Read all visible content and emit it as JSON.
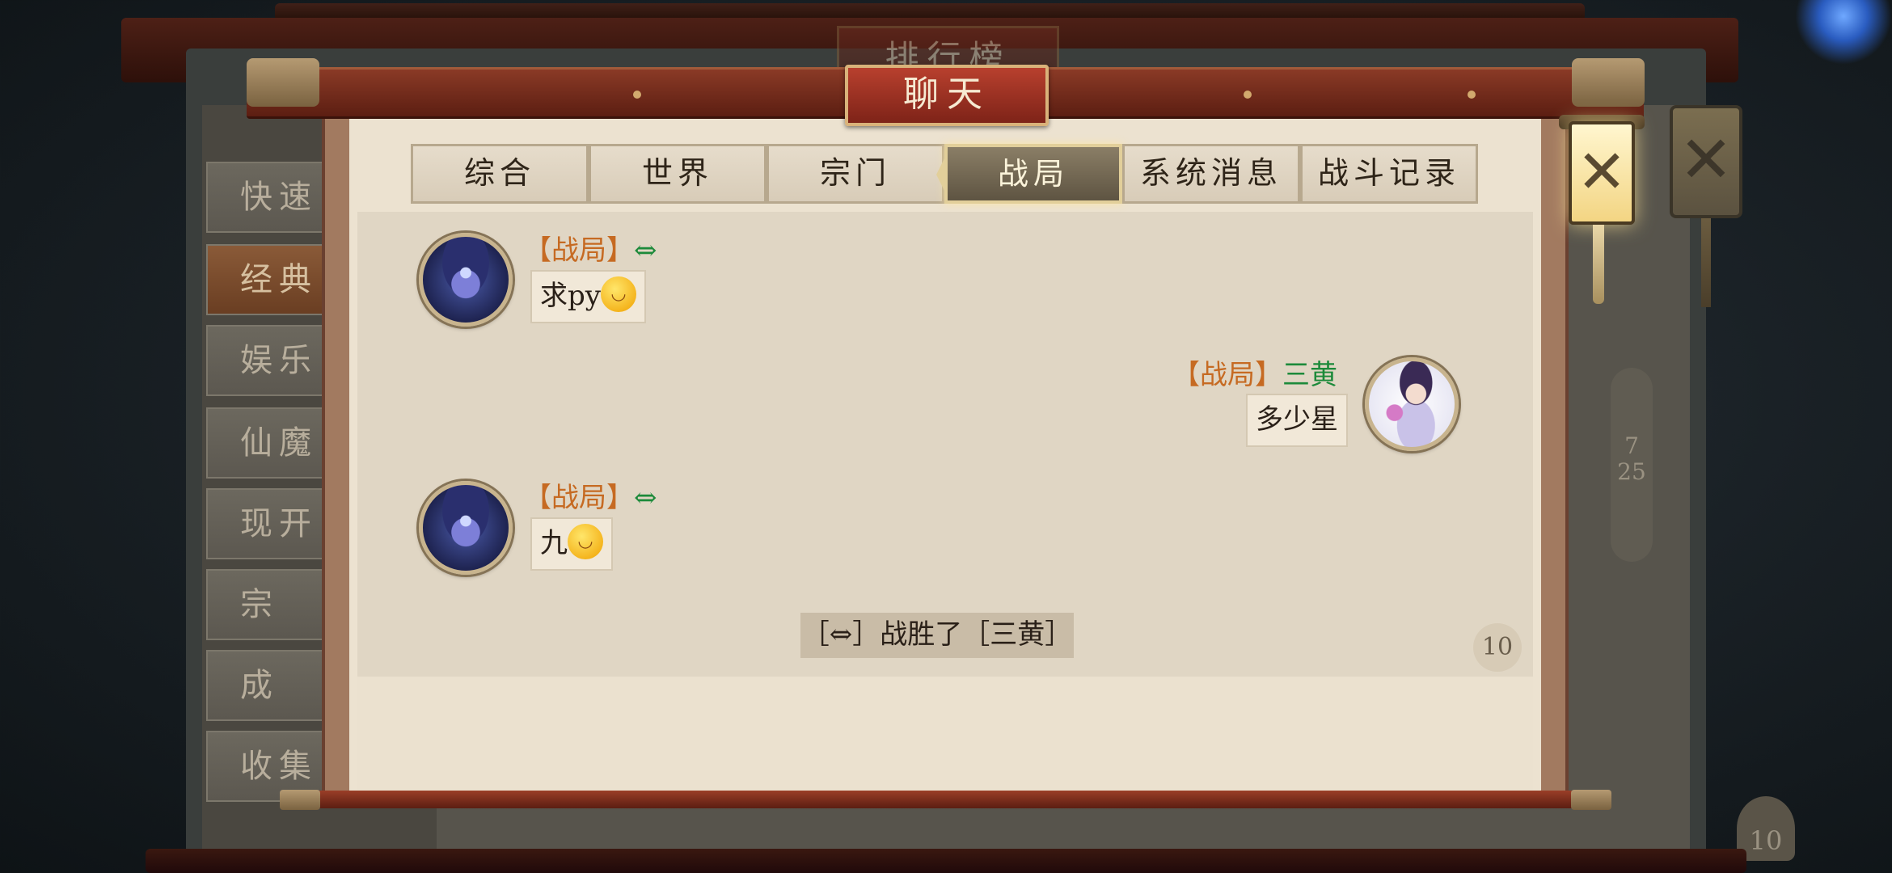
{
  "background": {
    "title": "排行榜",
    "side_items": [
      "快速",
      "经典",
      "娱乐",
      "仙魔",
      "现开",
      "宗",
      "成",
      "收集"
    ],
    "scroll_current": "7",
    "scroll_total": "25",
    "badge_value": "10",
    "close_glyph": "✕"
  },
  "dialog": {
    "title": "聊天",
    "close_glyph": "✕"
  },
  "tabs": [
    {
      "label": "综合",
      "active": false
    },
    {
      "label": "世界",
      "active": false
    },
    {
      "label": "宗门",
      "active": false
    },
    {
      "label": "战局",
      "active": true
    },
    {
      "label": "系统消息",
      "active": false
    },
    {
      "label": "战斗记录",
      "active": false
    }
  ],
  "messages": [
    {
      "channel": "【战局】",
      "sender": "⇔",
      "text": "求py",
      "emoji": "smile-emoji",
      "side": "left",
      "avatar": "mage-avatar"
    },
    {
      "channel": "【战局】",
      "sender": "三黄",
      "text": "多少星",
      "side": "right",
      "avatar": "lady-avatar"
    },
    {
      "channel": "【战局】",
      "sender": "⇔",
      "text": "九",
      "emoji": "smile-emoji",
      "side": "left",
      "avatar": "mage-avatar"
    }
  ],
  "system_note": "［⇔］战胜了［三黄］",
  "unread_count": "10",
  "colors": {
    "channel": "#c66a22",
    "sender": "#1c8a3a",
    "title_board": "#b8402e",
    "paper": "#ece2d0"
  }
}
